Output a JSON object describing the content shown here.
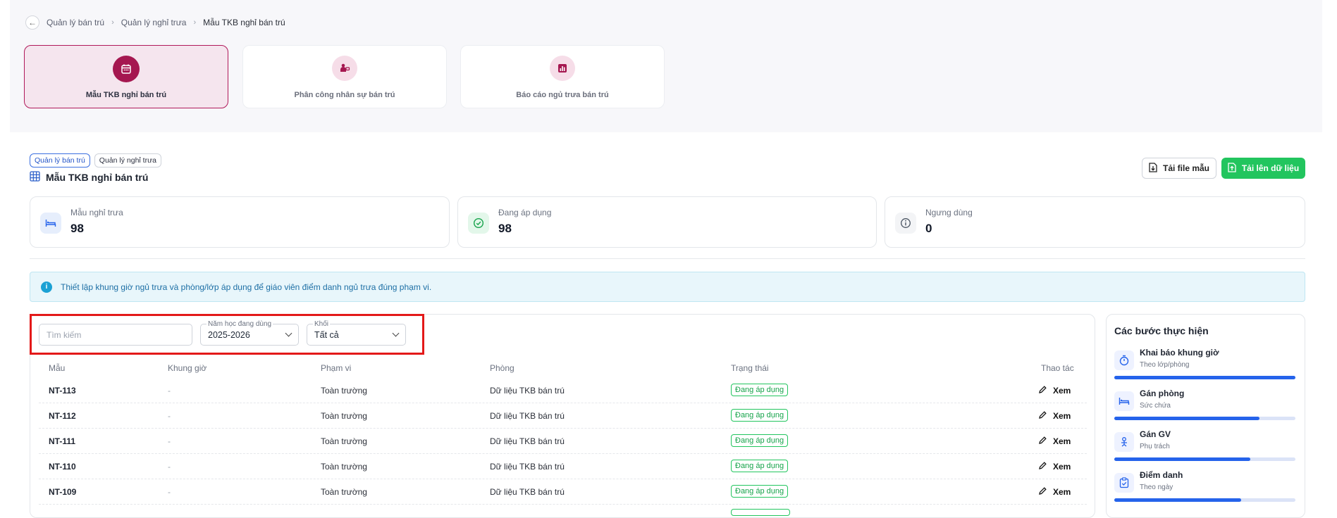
{
  "breadcrumb": [
    "Quản lý bán trú",
    "Quản lý nghỉ trưa",
    "Mẫu TKB nghỉ bán trú"
  ],
  "nav_cards": [
    {
      "label": "Mẫu TKB nghỉ bán trú",
      "icon": "calendar-icon",
      "active": true
    },
    {
      "label": "Phân công nhân sự bán trú",
      "icon": "staff-icon",
      "active": false
    },
    {
      "label": "Báo cáo ngủ trưa bán trú",
      "icon": "report-chart-icon",
      "active": false
    }
  ],
  "header": {
    "chips": [
      "Quản lý bán trú",
      "Quản lý nghỉ trưa"
    ],
    "title": "Mẫu TKB nghỉ bán trú",
    "download_label": "Tải file mẫu",
    "upload_label": "Tải lên dữ liệu"
  },
  "stats": [
    {
      "label": "Mẫu nghỉ trưa",
      "value": "98",
      "icon": "bed-icon"
    },
    {
      "label": "Đang áp dụng",
      "value": "98",
      "icon": "check-circle-icon"
    },
    {
      "label": "Ngưng dùng",
      "value": "0",
      "icon": "info-circle-icon"
    }
  ],
  "info_text": "Thiết lập khung giờ ngủ trưa và phòng/lớp áp dụng để giáo viên điểm danh ngủ trưa đúng phạm vi.",
  "filters": {
    "search_placeholder": "Tìm kiếm",
    "year_label": "Năm học đang dùng",
    "year_value": "2025-2026",
    "grade_label": "Khối",
    "grade_value": "Tất cả"
  },
  "table": {
    "headers": [
      "Mẫu",
      "Khung giờ",
      "Phạm vi",
      "Phòng",
      "Trạng thái",
      "Thao tác"
    ],
    "rows": [
      {
        "code": "NT-113",
        "time": "-",
        "scope": "Toàn trường",
        "room": "Dữ liệu TKB bán trú",
        "status": "Đang áp dụng",
        "action": "Xem"
      },
      {
        "code": "NT-112",
        "time": "-",
        "scope": "Toàn trường",
        "room": "Dữ liệu TKB bán trú",
        "status": "Đang áp dụng",
        "action": "Xem"
      },
      {
        "code": "NT-111",
        "time": "-",
        "scope": "Toàn trường",
        "room": "Dữ liệu TKB bán trú",
        "status": "Đang áp dụng",
        "action": "Xem"
      },
      {
        "code": "NT-110",
        "time": "-",
        "scope": "Toàn trường",
        "room": "Dữ liệu TKB bán trú",
        "status": "Đang áp dụng",
        "action": "Xem"
      },
      {
        "code": "NT-109",
        "time": "-",
        "scope": "Toàn trường",
        "room": "Dữ liệu TKB bán trú",
        "status": "Đang áp dụng",
        "action": "Xem"
      }
    ]
  },
  "steps": {
    "title": "Các bước thực hiện",
    "items": [
      {
        "name": "Khai báo khung giờ",
        "sub": "Theo lớp/phòng",
        "progress": 1.0,
        "icon": "timer-icon"
      },
      {
        "name": "Gán phòng",
        "sub": "Sức chứa",
        "progress": 0.8,
        "icon": "bed-icon"
      },
      {
        "name": "Gán GV",
        "sub": "Phụ trách",
        "progress": 0.75,
        "icon": "teacher-icon"
      },
      {
        "name": "Điểm danh",
        "sub": "Theo ngày",
        "progress": 0.7,
        "icon": "clipboard-check-icon"
      }
    ]
  },
  "colors": {
    "brand": "#a51750",
    "success": "#22c55e",
    "primary": "#2563eb",
    "info": "#1ba1d4"
  }
}
